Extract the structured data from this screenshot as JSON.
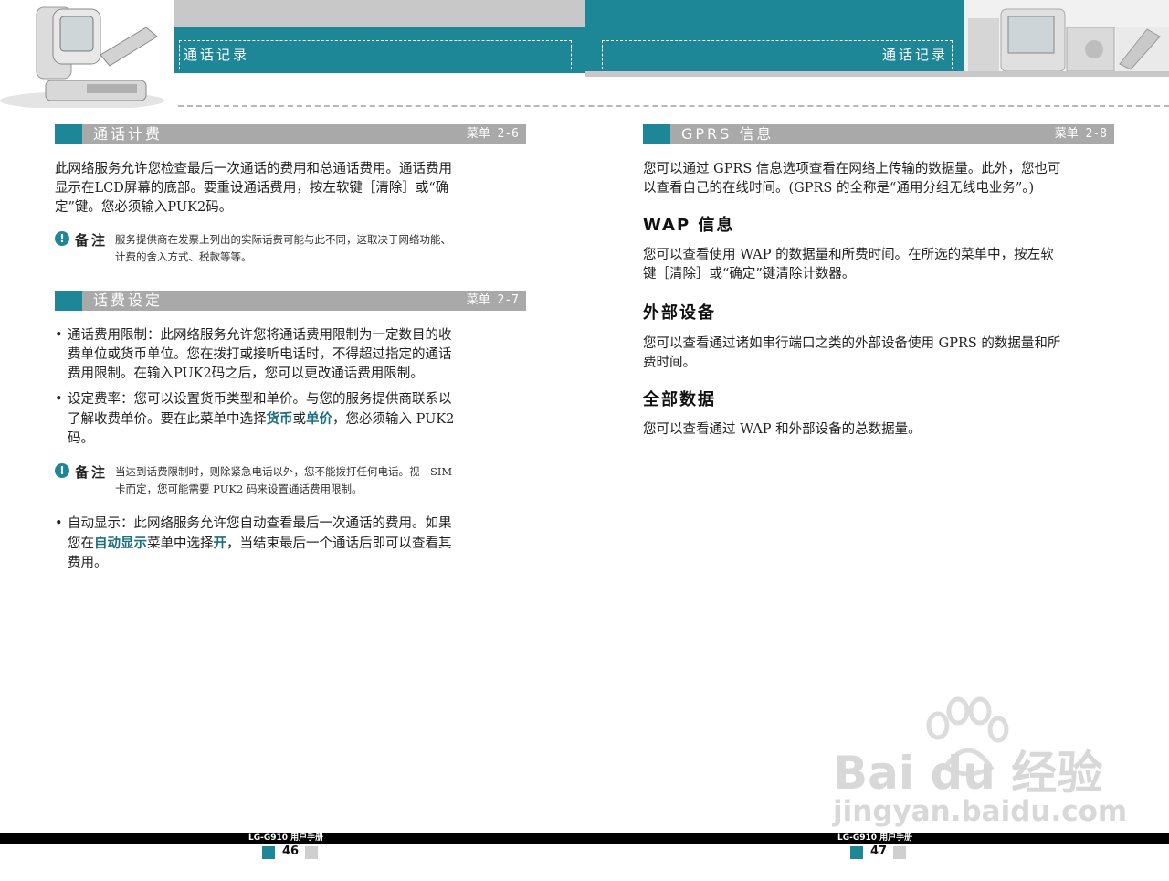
{
  "header": {
    "left_title": "通话记录",
    "right_title": "通话记录"
  },
  "left_page": {
    "sec1": {
      "title": "通话计费",
      "menu": "菜单 2-6",
      "body": [
        "此网络服务允许您检查最后一次通话的费用和总通话费用。通话费用",
        "显示在LCD屏幕的底部。要重设通话费用，按左软键［清除］或“确",
        "定”键。您必须输入PUK2码。"
      ],
      "note_label": "备注",
      "note_text": [
        "服务提供商在发票上列出的实际话费可能与此不同，这取决于网络功能、",
        "计费的舍入方式、税款等等。"
      ]
    },
    "sec2": {
      "title": "话费设定",
      "menu": "菜单 2-7",
      "bullet1": [
        "通话费用限制：此网络服务允许您将通话费用限制为一定数目的收",
        "费单位或货币单位。您在拨打或接听电话时，不得超过指定的通话",
        "费用限制。在输入PUK2码之后，您可以更改通话费用限制。"
      ],
      "bullet2_l1": "设定费率：您可以设置货币类型和单价。与您的服务提供商联系以",
      "bullet2_l2a": "了解收费单价。要在此菜单中选择",
      "bullet2_hl1": "货币",
      "bullet2_l2b": "或",
      "bullet2_hl2": "单价",
      "bullet2_l2c": "，您必须输入 PUK2",
      "bullet2_l3": "码。",
      "note_label": "备注",
      "note_text": [
        "当达到话费限制时，则除紧急电话以外，您不能拨打任何电话。视　SIM",
        "卡而定，您可能需要 PUK2 码来设置通话费用限制。"
      ],
      "bullet3_l1": "自动显示：此网络服务允许您自动查看最后一次通话的费用。如果",
      "bullet3_l2a": "您在",
      "bullet3_hl1": "自动显示",
      "bullet3_l2b": "菜单中选择",
      "bullet3_hl2": "开",
      "bullet3_l2c": "，当结束最后一个通话后即可以查看其",
      "bullet3_l3": "费用。"
    },
    "footer": {
      "manual": "LG-G910 用户手册",
      "page": "46"
    }
  },
  "right_page": {
    "sec1": {
      "title": "GPRS 信息",
      "menu": "菜单 2-8",
      "body": [
        "您可以通过 GPRS 信息选项查看在网络上传输的数据量。此外，您也可",
        "以查看自己的在线时间。(GPRS 的全称是“通用分组无线电业务”。)"
      ]
    },
    "wap": {
      "heading": "WAP 信息",
      "body": [
        "您可以查看使用 WAP 的数据量和所费时间。在所选的菜单中，按左软",
        "键［清除］或“确定”键清除计数器。"
      ]
    },
    "ext": {
      "heading": "外部设备",
      "body": [
        "您可以查看通过诸如串行端口之类的外部设备使用 GPRS 的数据量和所",
        "费时间。"
      ]
    },
    "all": {
      "heading": "全部数据",
      "body": [
        "您可以查看通过 WAP 和外部设备的总数据量。"
      ]
    },
    "footer": {
      "manual": "LG-G910 用户手册",
      "page": "47"
    }
  },
  "watermark": {
    "brand": "Bai du 经验",
    "url": "jingyan.baidu.com"
  },
  "colors": {
    "accent": "#1d8697",
    "bar_grey": "#a9a9a9"
  }
}
